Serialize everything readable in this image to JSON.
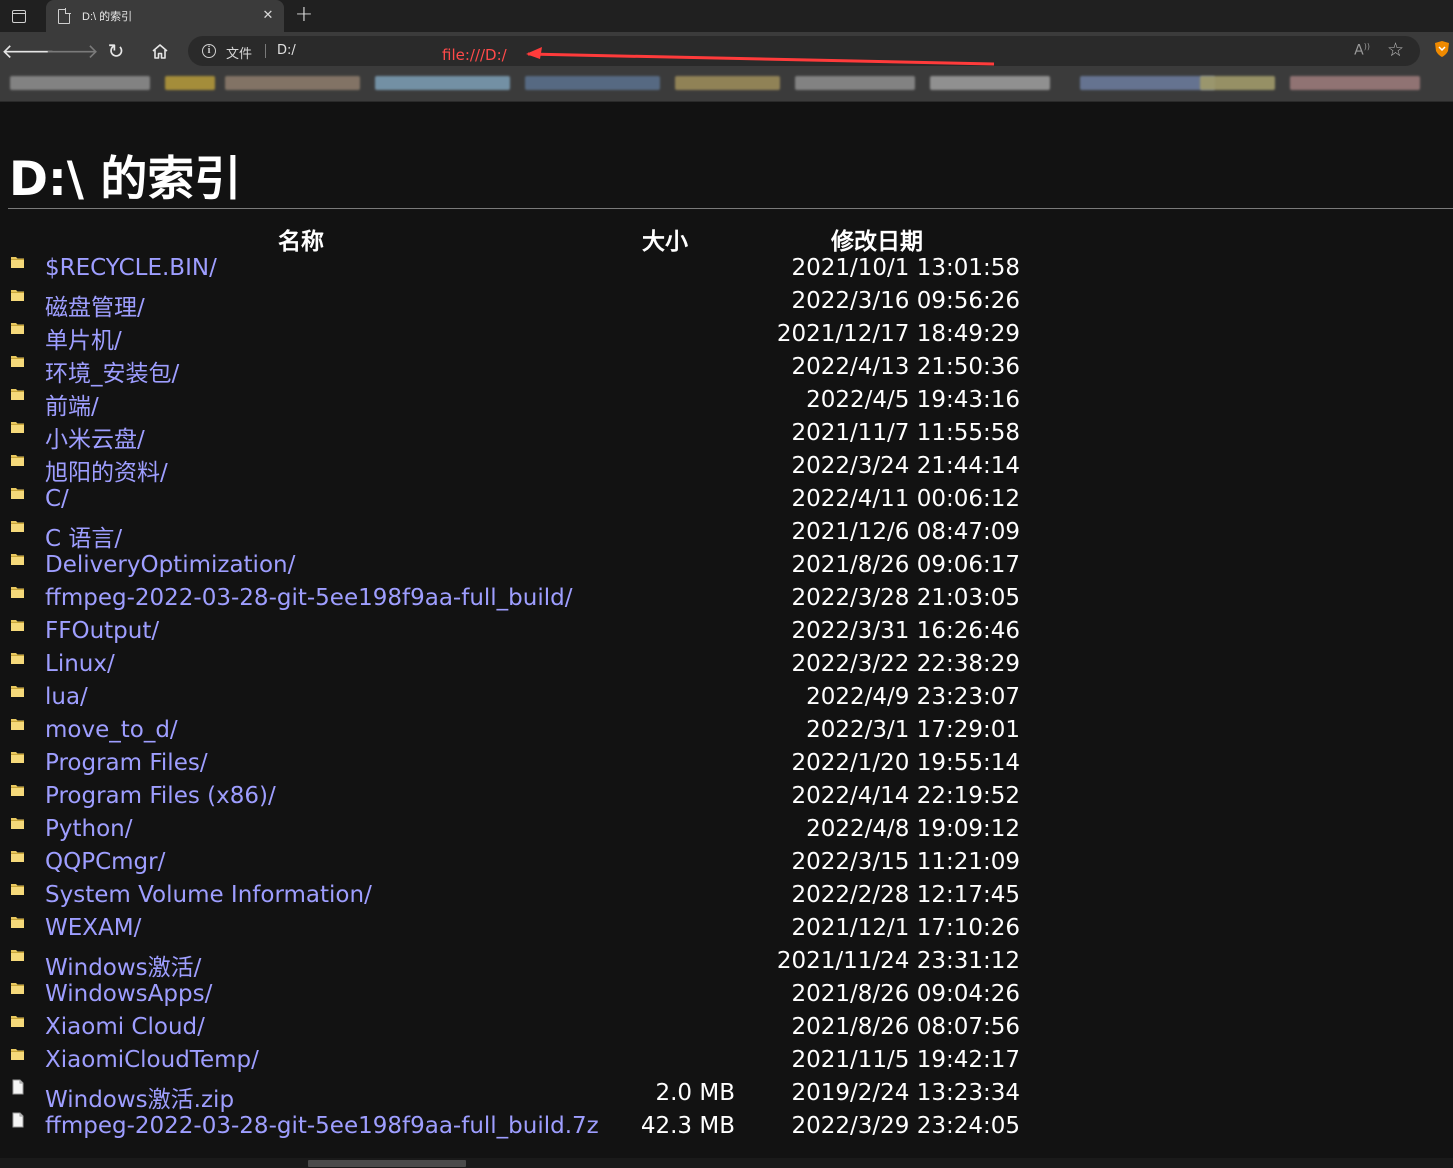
{
  "browser": {
    "tab": {
      "title": "D:\\ 的索引"
    },
    "toolbar": {
      "scheme_label": "文件",
      "url": "D:/",
      "annotation": "file:///D:/"
    },
    "colors": {
      "link": "#9e9eff",
      "annotation": "#ff4a4a",
      "background": "#121212"
    }
  },
  "page": {
    "heading": "D:\\ 的索引",
    "columns": {
      "name": "名称",
      "size": "大小",
      "date": "修改日期"
    },
    "rows": [
      {
        "type": "folder",
        "name": "$RECYCLE.BIN/",
        "size": "",
        "date": "2021/10/1 13:01:58"
      },
      {
        "type": "folder",
        "name": "磁盘管理/",
        "size": "",
        "date": "2022/3/16 09:56:26"
      },
      {
        "type": "folder",
        "name": "单片机/",
        "size": "",
        "date": "2021/12/17 18:49:29"
      },
      {
        "type": "folder",
        "name": "环境_安装包/",
        "size": "",
        "date": "2022/4/13 21:50:36"
      },
      {
        "type": "folder",
        "name": "前端/",
        "size": "",
        "date": "2022/4/5 19:43:16"
      },
      {
        "type": "folder",
        "name": "小米云盘/",
        "size": "",
        "date": "2021/11/7 11:55:58"
      },
      {
        "type": "folder",
        "name": "旭阳的资料/",
        "size": "",
        "date": "2022/3/24 21:44:14"
      },
      {
        "type": "folder",
        "name": "C/",
        "size": "",
        "date": "2022/4/11 00:06:12"
      },
      {
        "type": "folder",
        "name": "C 语言/",
        "size": "",
        "date": "2021/12/6 08:47:09"
      },
      {
        "type": "folder",
        "name": "DeliveryOptimization/",
        "size": "",
        "date": "2021/8/26 09:06:17"
      },
      {
        "type": "folder",
        "name": "ffmpeg-2022-03-28-git-5ee198f9aa-full_build/",
        "size": "",
        "date": "2022/3/28 21:03:05"
      },
      {
        "type": "folder",
        "name": "FFOutput/",
        "size": "",
        "date": "2022/3/31 16:26:46"
      },
      {
        "type": "folder",
        "name": "Linux/",
        "size": "",
        "date": "2022/3/22 22:38:29"
      },
      {
        "type": "folder",
        "name": "lua/",
        "size": "",
        "date": "2022/4/9 23:23:07"
      },
      {
        "type": "folder",
        "name": "move_to_d/",
        "size": "",
        "date": "2022/3/1 17:29:01"
      },
      {
        "type": "folder",
        "name": "Program Files/",
        "size": "",
        "date": "2022/1/20 19:55:14"
      },
      {
        "type": "folder",
        "name": "Program Files (x86)/",
        "size": "",
        "date": "2022/4/14 22:19:52"
      },
      {
        "type": "folder",
        "name": "Python/",
        "size": "",
        "date": "2022/4/8 19:09:12"
      },
      {
        "type": "folder",
        "name": "QQPCmgr/",
        "size": "",
        "date": "2022/3/15 11:21:09"
      },
      {
        "type": "folder",
        "name": "System Volume Information/",
        "size": "",
        "date": "2022/2/28 12:17:45"
      },
      {
        "type": "folder",
        "name": "WEXAM/",
        "size": "",
        "date": "2021/12/1 17:10:26"
      },
      {
        "type": "folder",
        "name": "Windows激活/",
        "size": "",
        "date": "2021/11/24 23:31:12"
      },
      {
        "type": "folder",
        "name": "WindowsApps/",
        "size": "",
        "date": "2021/8/26 09:04:26"
      },
      {
        "type": "folder",
        "name": "Xiaomi Cloud/",
        "size": "",
        "date": "2021/8/26 08:07:56"
      },
      {
        "type": "folder",
        "name": "XiaomiCloudTemp/",
        "size": "",
        "date": "2021/11/5 19:42:17"
      },
      {
        "type": "file",
        "name": "Windows激活.zip",
        "size": "2.0 MB",
        "date": "2019/2/24 13:23:34"
      },
      {
        "type": "file",
        "name": "ffmpeg-2022-03-28-git-5ee198f9aa-full_build.7z",
        "size": "42.3 MB",
        "date": "2022/3/29 23:24:05"
      }
    ]
  }
}
